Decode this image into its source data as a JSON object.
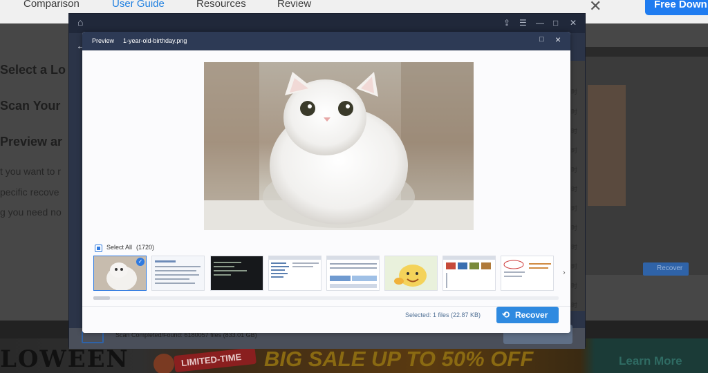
{
  "site_nav": {
    "links": [
      "Comparison",
      "User Guide",
      "Resources",
      "Review"
    ],
    "active": "User Guide",
    "download_label": "Free Down",
    "close_icon": "close-icon"
  },
  "article": {
    "headings": [
      "Select a Lo",
      "Scan Your",
      "Preview ar"
    ],
    "paragraph_lines": [
      "t you want to r",
      "pecific recove",
      "g you need no"
    ]
  },
  "banner": {
    "halloween": "LOWEEN",
    "badge": "LIMITED-TIME",
    "sale": "BIG SALE UP TO 50% OFF",
    "learn_more": "Learn More"
  },
  "app_window": {
    "status_text": "Scan Completed/Found: 6180057 files (833.01 GB)",
    "edge_labels": [
      "时",
      "时",
      "时",
      "时",
      "时",
      "时",
      "时",
      "时",
      "时",
      "时",
      "时",
      "时"
    ],
    "side_panel_recover": "Recover",
    "side_panel_found": "Found: 6180057"
  },
  "preview_dialog": {
    "title": "Preview",
    "filename": "1-year-old-birthday.png",
    "select_all_label": "Select All",
    "select_all_count": "(1720)",
    "selected_info": "Selected: 1 files (22.87 KB)",
    "recover_label": "Recover",
    "thumbnails": [
      "cat-photo",
      "doc-screenshot",
      "terminal-screenshot",
      "explorer-screenshot",
      "disk-manager-screenshot",
      "cartoon-sticker",
      "file-grid-screenshot",
      "annotated-diagram"
    ]
  },
  "colors": {
    "accent": "#2f8ae0",
    "title_bar": "#2d3a55",
    "nav_active": "#1e7fe0"
  }
}
